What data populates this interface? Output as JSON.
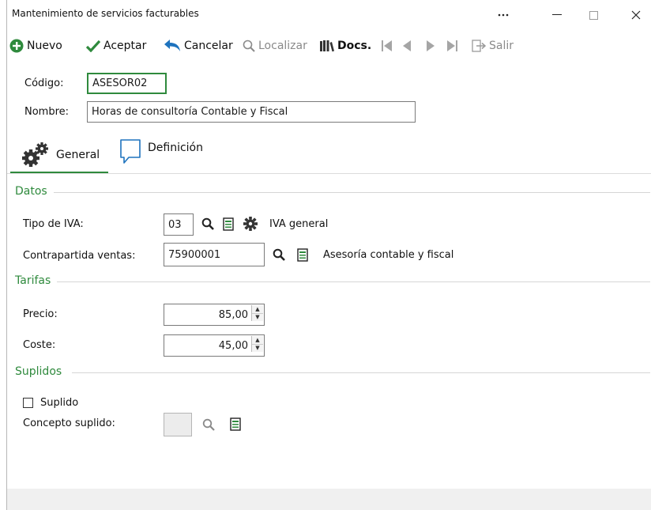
{
  "window": {
    "title": "Mantenimiento de servicios facturables",
    "controls": {
      "more": "…",
      "minimize": "—",
      "maximize": "☐",
      "close": "✕"
    }
  },
  "toolbar": {
    "nuevo": "Nuevo",
    "aceptar": "Aceptar",
    "cancelar": "Cancelar",
    "localizar": "Localizar",
    "docs": "Docs.",
    "salir": "Salir"
  },
  "form": {
    "codigo_label": "Código:",
    "codigo_value": "ASESOR02",
    "nombre_label": "Nombre:",
    "nombre_value": "Horas de consultoría Contable y Fiscal"
  },
  "tabs": [
    {
      "label": "General",
      "active": true,
      "icon": "gears-icon"
    },
    {
      "label": "Definición",
      "active": false,
      "icon": "speech-bubble-icon"
    }
  ],
  "datos": {
    "title": "Datos",
    "tipo_iva_label": "Tipo de IVA:",
    "tipo_iva_value": "03",
    "tipo_iva_desc": "IVA general",
    "contrapartida_label": "Contrapartida ventas:",
    "contrapartida_value": "75900001",
    "contrapartida_desc": "Asesoría contable y fiscal"
  },
  "tarifas": {
    "title": "Tarifas",
    "precio_label": "Precio:",
    "precio_value": "85,00",
    "coste_label": "Coste:",
    "coste_value": "45,00"
  },
  "suplidos": {
    "title": "Suplidos",
    "suplido_label": "Suplido",
    "suplido_checked": false,
    "concepto_label": "Concepto suplido:",
    "concepto_value": ""
  },
  "colors": {
    "accent": "#2f8a3d",
    "link_blue": "#1e73be"
  }
}
